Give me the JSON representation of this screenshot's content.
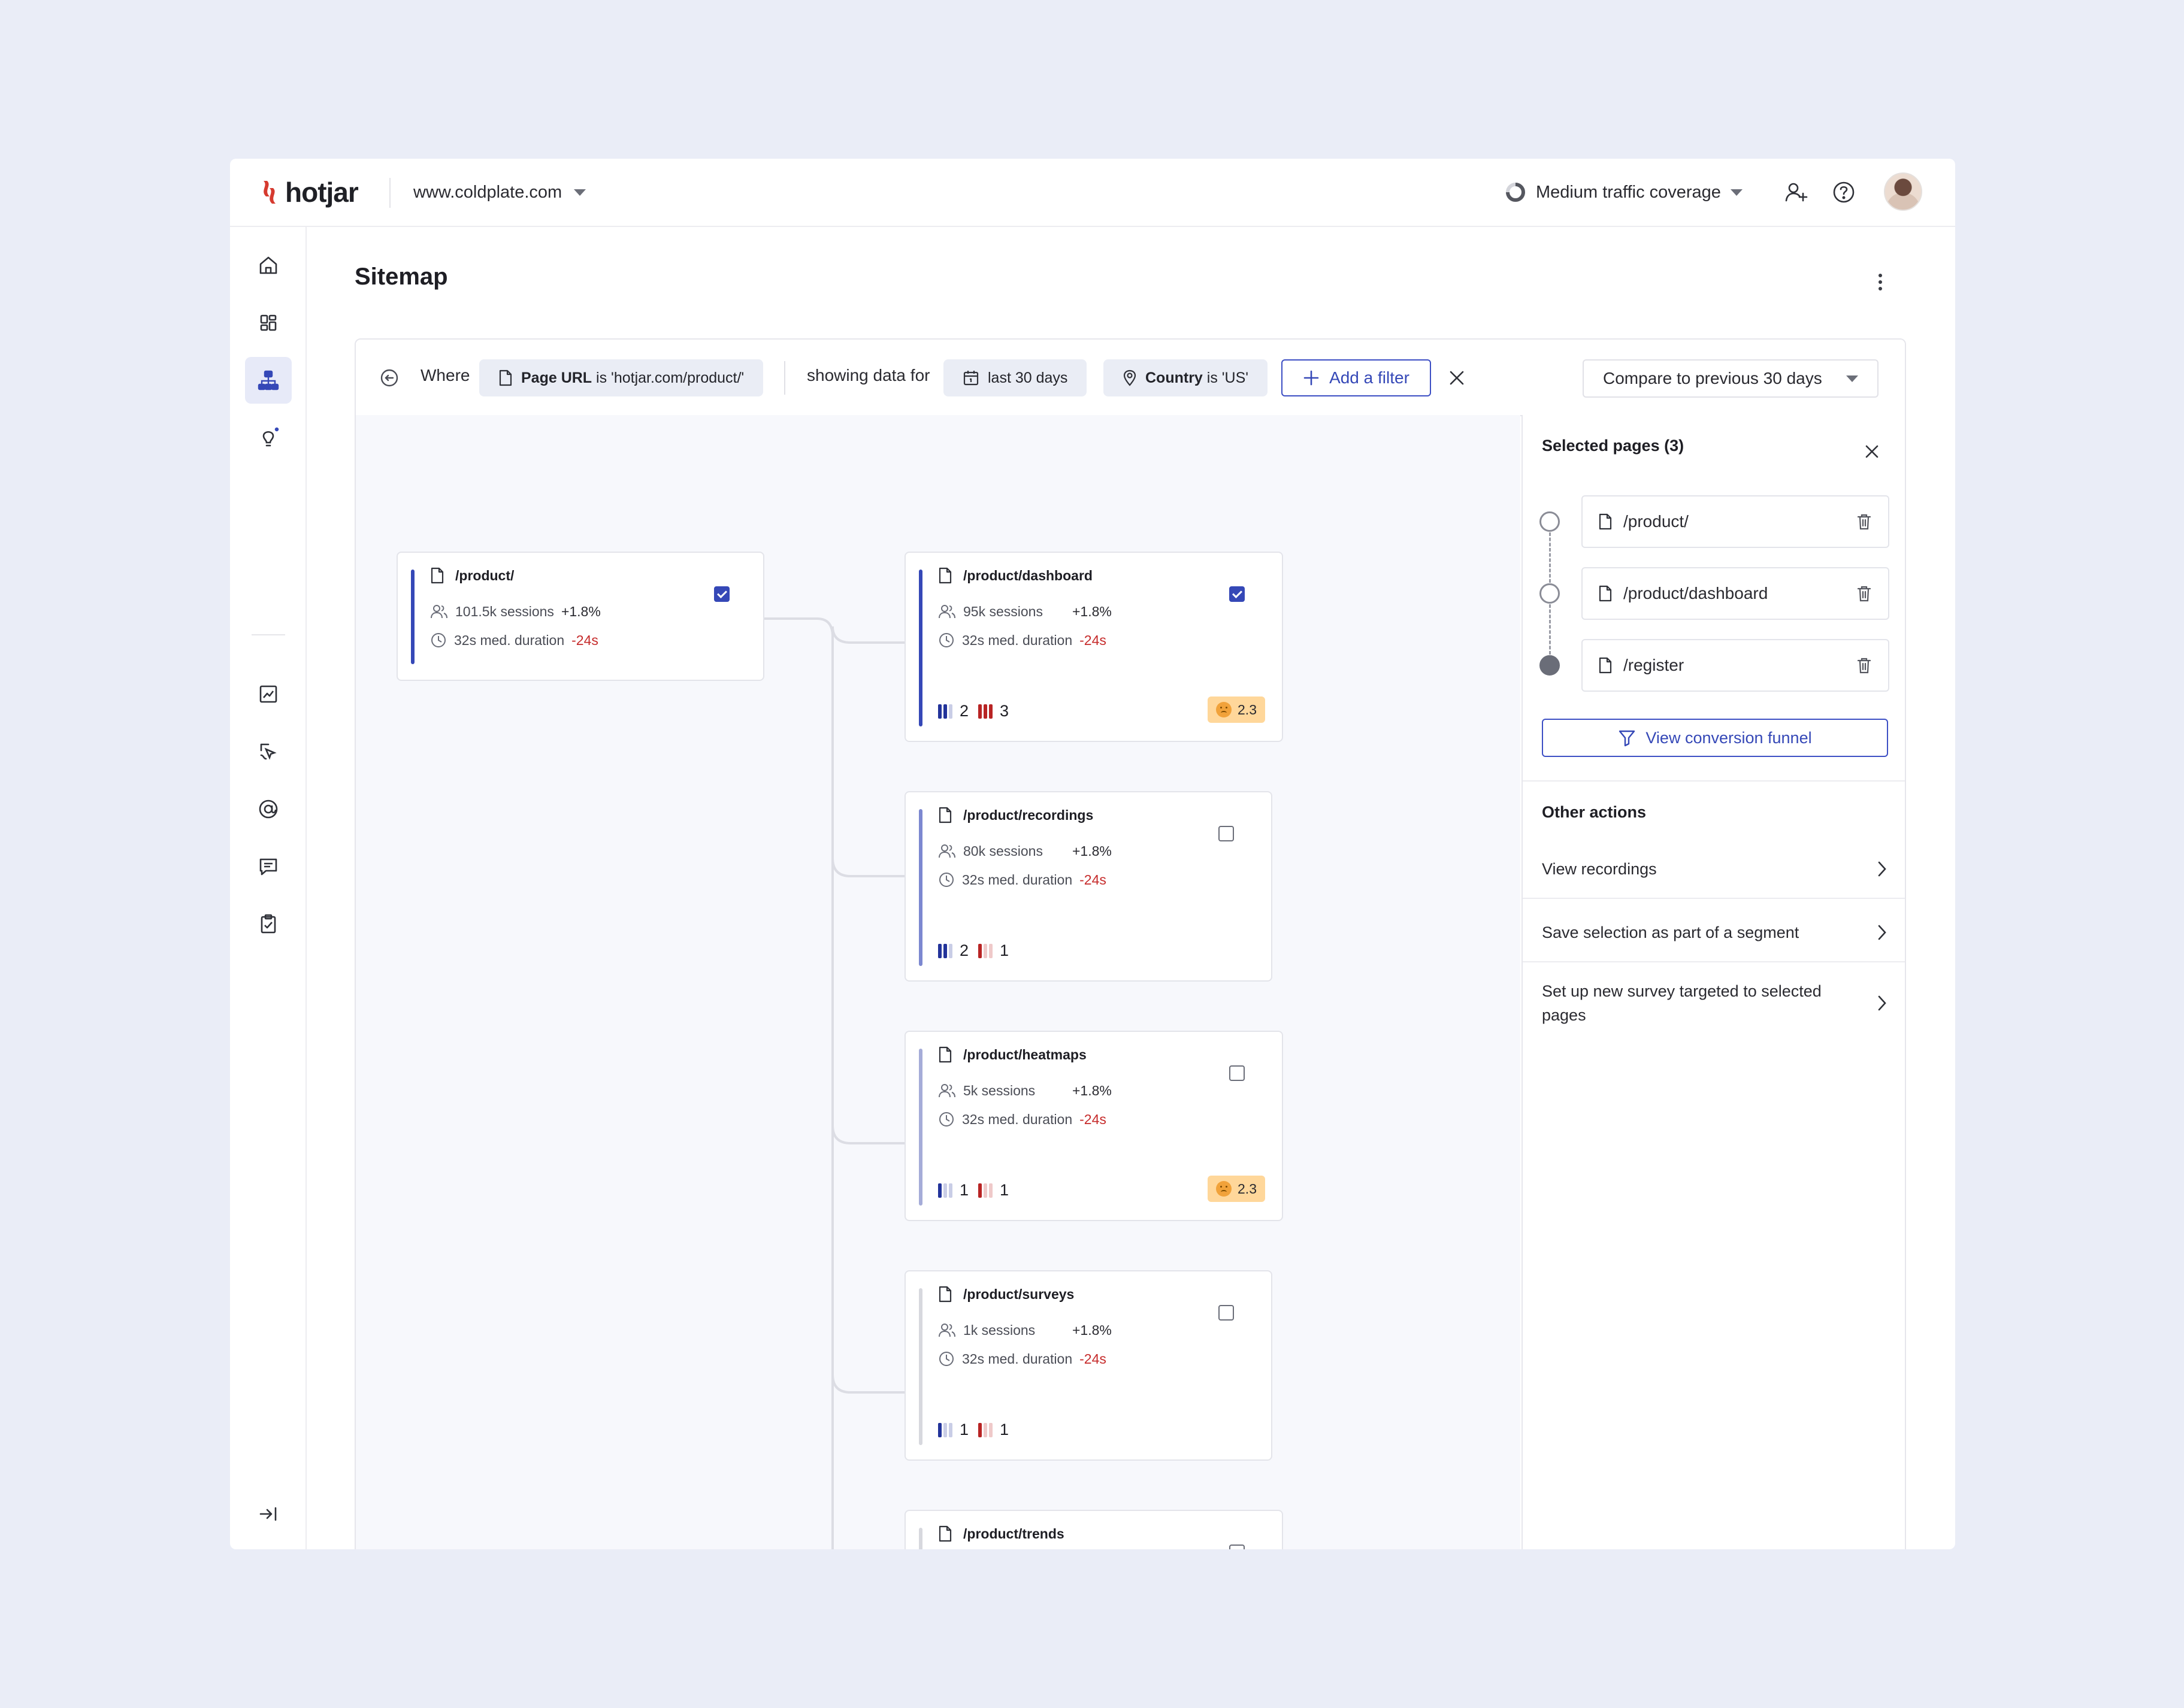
{
  "header": {
    "logo": "hotjar",
    "site": "www.coldplate.com",
    "coverage": "Medium traffic coverage"
  },
  "page": {
    "title": "Sitemap"
  },
  "filters": {
    "where": "Where",
    "page_url_key": "Page URL",
    "page_url_value": "is 'hotjar.com/product/'",
    "showing": "showing data for",
    "range": "last 30 days",
    "country_key": "Country",
    "country_value": "is 'US'",
    "add_filter": "Add a filter",
    "compare": "Compare to previous 30 days"
  },
  "cards": [
    {
      "path": "/product/",
      "sessions": "101.5k sessions",
      "sessions_delta": "+1.8%",
      "duration": "32s med. duration",
      "duration_delta": "-24s",
      "checked": true
    },
    {
      "path": "/product/dashboard",
      "sessions": "95k sessions",
      "sessions_delta": "+1.8%",
      "duration": "32s med. duration",
      "duration_delta": "-24s",
      "blue": "2",
      "red": "3",
      "sentiment": "2.3",
      "checked": true
    },
    {
      "path": "/product/recordings",
      "sessions": "80k sessions",
      "sessions_delta": "+1.8%",
      "duration": "32s med. duration",
      "duration_delta": "-24s",
      "blue": "2",
      "red": "1",
      "checked": false
    },
    {
      "path": "/product/heatmaps",
      "sessions": "5k sessions",
      "sessions_delta": "+1.8%",
      "duration": "32s med. duration",
      "duration_delta": "-24s",
      "blue": "1",
      "red": "1",
      "sentiment": "2.3",
      "checked": false
    },
    {
      "path": "/product/surveys",
      "sessions": "1k sessions",
      "sessions_delta": "+1.8%",
      "duration": "32s med. duration",
      "duration_delta": "-24s",
      "blue": "1",
      "red": "1",
      "checked": false
    },
    {
      "path": "/product/trends",
      "checked": false
    }
  ],
  "selected": {
    "title": "Selected pages (3)",
    "items": [
      "/product/",
      "/product/dashboard",
      "/register"
    ],
    "funnel_button": "View conversion funnel"
  },
  "other_actions": {
    "title": "Other actions",
    "items": [
      "View recordings",
      "Save selection as part of a segment",
      "Set up new survey targeted to selected pages"
    ]
  },
  "colors": {
    "accent": "#3548b7",
    "brand": "#d63a2f",
    "negative": "#c62b2b",
    "sentiment": "#ffd79a"
  }
}
